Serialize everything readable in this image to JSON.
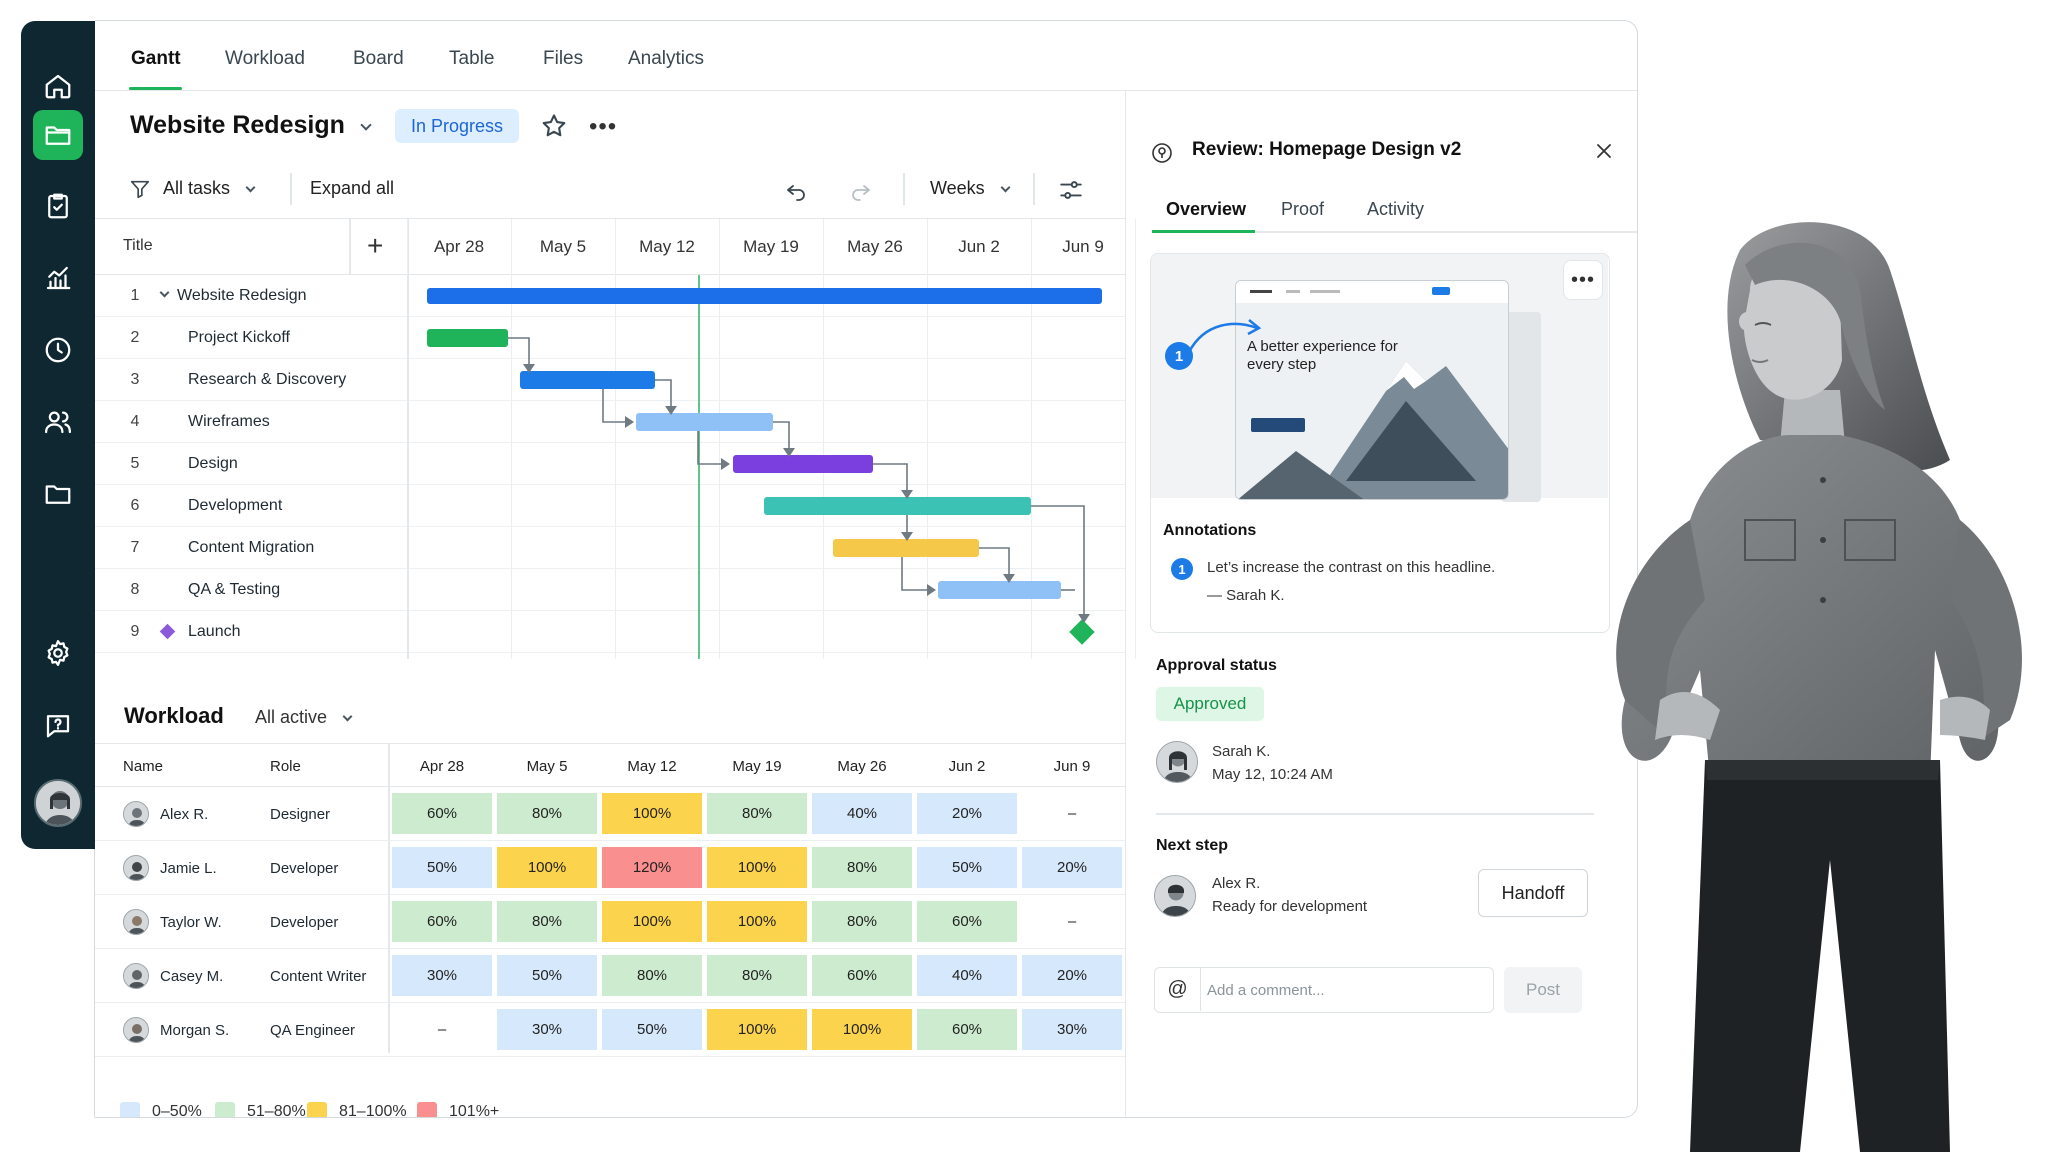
{
  "nav": {
    "tabs": [
      {
        "label": "Gantt",
        "active": true
      },
      {
        "label": "Workload"
      },
      {
        "label": "Board"
      },
      {
        "label": "Table"
      },
      {
        "label": "Files"
      },
      {
        "label": "Analytics"
      }
    ]
  },
  "rail": {
    "items": [
      "home-icon",
      "folder-icon",
      "clipboard-check-icon",
      "chart-icon",
      "clock-icon",
      "users-icon",
      "folder-icon",
      "gear-icon",
      "help-icon"
    ],
    "active_index": 1
  },
  "project": {
    "title": "Website Redesign",
    "status": "In Progress"
  },
  "toolbar": {
    "filter_label": "All tasks",
    "expand_label": "Expand all",
    "scale_label": "Weeks"
  },
  "gantt": {
    "title_header": "Title",
    "weeks": [
      "Apr 28",
      "May 5",
      "May 12",
      "May 19",
      "May 26",
      "Jun 2",
      "Jun 9"
    ],
    "today_marker": "May 12",
    "tasks": [
      {
        "num": "1",
        "name": "Website Redesign",
        "group": true
      },
      {
        "num": "2",
        "name": "Project Kickoff"
      },
      {
        "num": "3",
        "name": "Research & Discovery"
      },
      {
        "num": "4",
        "name": "Wireframes"
      },
      {
        "num": "5",
        "name": "Design"
      },
      {
        "num": "6",
        "name": "Development"
      },
      {
        "num": "7",
        "name": "Content Migration"
      },
      {
        "num": "8",
        "name": "QA & Testing"
      },
      {
        "num": "9",
        "name": "Launch",
        "milestone": true
      }
    ],
    "colors": {
      "group": "#1c6fe8",
      "kickoff": "#1fb35a",
      "research": "#1c7be6",
      "wireframes": "#8fc1f7",
      "design": "#7b3fe0",
      "development": "#3cc2b5",
      "content": "#f5c84a",
      "qa": "#8fc1f7",
      "launch": "#1fb35a"
    }
  },
  "workload": {
    "title": "Workload",
    "filter": "All active",
    "headers": {
      "name": "Name",
      "role": "Role"
    },
    "weeks": [
      "Apr 28",
      "May 5",
      "May 12",
      "May 19",
      "May 26",
      "Jun 2",
      "Jun 9"
    ],
    "rows": [
      {
        "name": "Alex R.",
        "role": "Designer",
        "values": [
          "60%",
          "80%",
          "100%",
          "80%",
          "40%",
          "20%",
          "–"
        ]
      },
      {
        "name": "Jamie L.",
        "role": "Developer",
        "values": [
          "50%",
          "100%",
          "120%",
          "100%",
          "80%",
          "50%",
          "20%"
        ]
      },
      {
        "name": "Taylor W.",
        "role": "Developer",
        "values": [
          "60%",
          "80%",
          "100%",
          "100%",
          "80%",
          "60%",
          "–"
        ]
      },
      {
        "name": "Casey M.",
        "role": "Content Writer",
        "values": [
          "30%",
          "50%",
          "80%",
          "80%",
          "60%",
          "40%",
          "20%"
        ]
      },
      {
        "name": "Morgan S.",
        "role": "QA Engineer",
        "values": [
          "–",
          "30%",
          "50%",
          "100%",
          "100%",
          "60%",
          "30%"
        ]
      }
    ],
    "legend": [
      {
        "label": "0–50%",
        "color": "#d6e8fb"
      },
      {
        "label": "51–80%",
        "color": "#cdeccf"
      },
      {
        "label": "81–100%",
        "color": "#fcd34d"
      },
      {
        "label": "101%+",
        "color": "#f98f8f"
      }
    ]
  },
  "panel": {
    "title": "Review: Homepage Design v2",
    "tabs": [
      "Overview",
      "Proof",
      "Activity"
    ],
    "proof_headline": "A better experience for every step",
    "annotations_label": "Annotations",
    "annotation": {
      "num": "1",
      "text": "Let’s increase the contrast on this headline.",
      "author": "— Sarah K."
    },
    "approval_label": "Approval status",
    "approval_status": "Approved",
    "approver": {
      "name": "Sarah K.",
      "time": "May 12, 10:24 AM"
    },
    "next_step_label": "Next step",
    "next_person": {
      "name": "Alex R.",
      "note": "Ready for development"
    },
    "handoff_label": "Handoff",
    "comment_placeholder": "Add a comment...",
    "post_label": "Post"
  }
}
